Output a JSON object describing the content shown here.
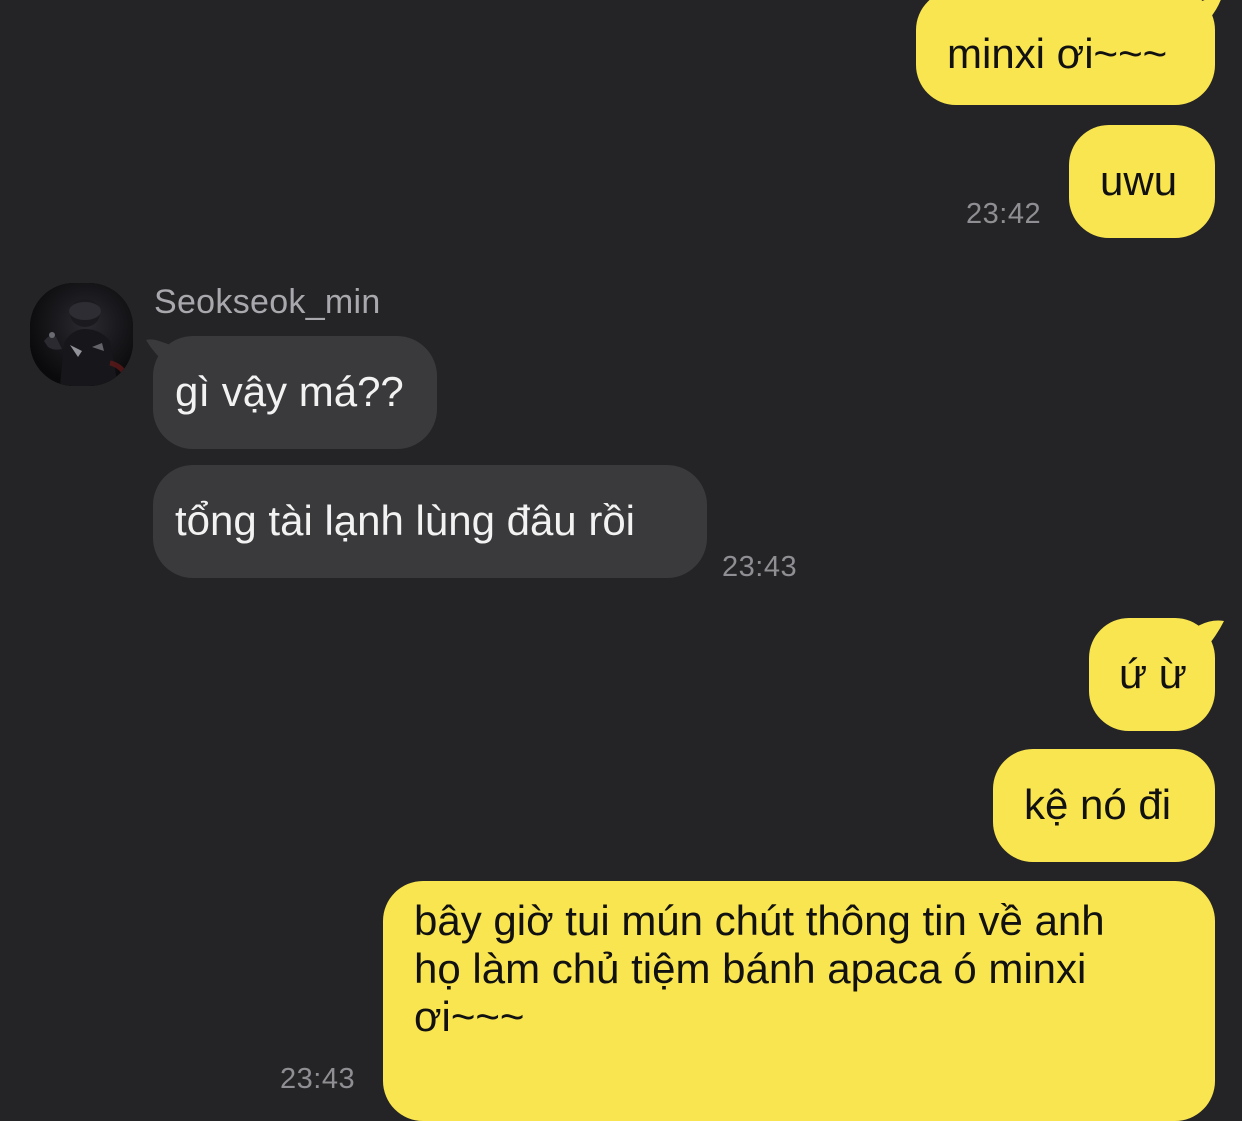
{
  "contact": {
    "name": "Seokseok_min"
  },
  "messages": [
    {
      "id": "m1",
      "from": "me",
      "text": "minxi ơi~~~"
    },
    {
      "id": "m2",
      "from": "me",
      "text": "uwu",
      "time": "23:42"
    },
    {
      "id": "m3",
      "from": "them",
      "text": "gì vậy má??"
    },
    {
      "id": "m4",
      "from": "them",
      "text": "tổng tài lạnh lùng đâu rồi",
      "time": "23:43"
    },
    {
      "id": "m5",
      "from": "me",
      "text": "ứ ừ"
    },
    {
      "id": "m6",
      "from": "me",
      "text": "kệ nó đi"
    },
    {
      "id": "m7",
      "from": "me",
      "lines": [
        "bây giờ tui mún chút thông tin về anh",
        "họ làm chủ tiệm bánh apaca ó minxi",
        "ơi~~~"
      ],
      "time": "23:43"
    }
  ],
  "colors": {
    "background": "#242426",
    "sent_bubble": "#f9e54f",
    "received_bubble": "#3a3a3c",
    "timestamp": "#8e8e93"
  }
}
